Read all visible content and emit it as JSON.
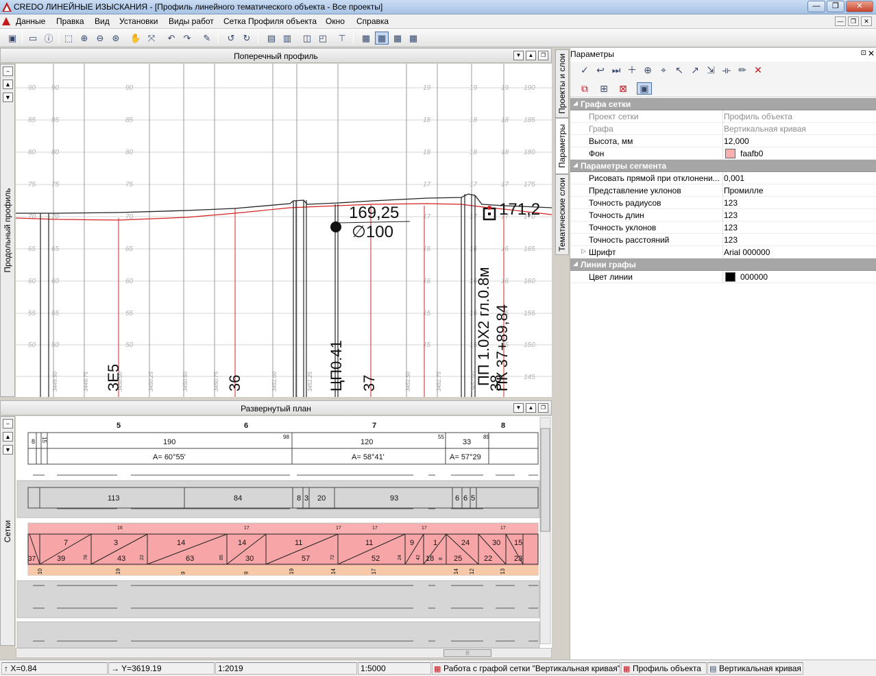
{
  "window": {
    "title": "CREDO ЛИНЕЙНЫЕ ИЗЫСКАНИЯ - [Профиль линейного тематического объекта - Все проекты]",
    "controls": [
      "—",
      "❐",
      "✕"
    ]
  },
  "menu": [
    "Данные",
    "Правка",
    "Вид",
    "Установки",
    "Виды работ",
    "Сетка Профиля объекта",
    "Окно",
    "Справка"
  ],
  "toolbar_icons": [
    "layers-icon",
    "window-icon",
    "info-icon",
    "zoom-box-icon",
    "zoom-in-icon",
    "zoom-out-icon",
    "zoom-all-icon",
    "pan-icon",
    "fit-icon",
    "zoom-prev-icon",
    "zoom-next-icon",
    "brush-icon",
    "undo-icon",
    "redo-icon",
    "table-icon",
    "chart-icon",
    "profile-icon",
    "profile2-icon",
    "insert-icon",
    "grid-ph-icon",
    "grid-pn-icon",
    "grid-pg-icon",
    "grid-pr-icon"
  ],
  "cross_section": {
    "title": "Поперечный профиль",
    "side_label": "Продольный профиль",
    "elev_left": [
      "190",
      "185",
      "180",
      "175",
      "170",
      "165",
      "160",
      "155",
      "150"
    ],
    "elev_mid": [
      "90",
      "85",
      "80",
      "75",
      "70",
      "65",
      "60",
      "55",
      "50"
    ],
    "elev_right": [
      "190",
      "185",
      "180",
      "175",
      "170",
      "165",
      "160",
      "155",
      "150",
      "145"
    ],
    "elev_inner": [
      "19",
      "18",
      "18",
      "17",
      "17",
      "16",
      "16",
      "15",
      "15"
    ],
    "callout_top": "169,25",
    "callout_bottom": "∅100",
    "callout_right": "171,2",
    "vertical_label_1": "ПП 1.0Х2 гл.0.8м",
    "vertical_label_2": "ПК 37+89,84",
    "vertical_label_3": "ЦП0.41",
    "pk_labels": [
      "ЗЕ5",
      "36",
      "37",
      "38"
    ],
    "small_labels": [
      "3449.50",
      "3449.75",
      "3450.00",
      "3450.25",
      "3450.50",
      "3450.75",
      "3451.00",
      "3451.25",
      "3451.50",
      "3451.75",
      "3452.00"
    ]
  },
  "plan": {
    "title": "Развернутый план",
    "side_label": "Сетки",
    "columns": [
      "5",
      "6",
      "7",
      "8"
    ],
    "row1_values": [
      "8",
      "15",
      "190",
      "98",
      "120",
      "55",
      "33",
      "89"
    ],
    "row1_angles": [
      "A= 60°55'",
      "A= 58°41'",
      "A= 57°29"
    ],
    "row2_values": [
      "113",
      "84",
      "8",
      "3",
      "20",
      "93",
      "6",
      "6",
      "5"
    ],
    "row3_top": [
      "7",
      "3",
      "14",
      "14",
      "11",
      "11",
      "9",
      "1",
      "24",
      "30",
      "15"
    ],
    "row3_bottom": [
      "37",
      "39",
      "43",
      "63",
      "30",
      "57",
      "52",
      "18",
      "25",
      "22",
      "23"
    ],
    "row3_marks": [
      "16",
      "17",
      "17",
      "17",
      "17",
      "17"
    ],
    "row3_small": [
      "78",
      "22",
      "85",
      "72",
      "24",
      "42",
      "8"
    ],
    "row3_foot": [
      "10",
      "19",
      "9",
      "9",
      "19",
      "14",
      "17",
      "14",
      "12",
      "13"
    ]
  },
  "properties": {
    "title": "Параметры",
    "pin": "⊡",
    "close": "✕",
    "tabs": [
      "Проекты и слои",
      "Параметры",
      "Тематические слои"
    ],
    "rows": [
      {
        "type": "section",
        "name": "Графа сетки"
      },
      {
        "type": "dim",
        "name": "Проект сетки",
        "value": "Профиль объекта"
      },
      {
        "type": "dim",
        "name": "Графа",
        "value": "Вертикальная кривая"
      },
      {
        "type": "row",
        "name": "Высота, мм",
        "value": "12,000"
      },
      {
        "type": "color",
        "name": "Фон",
        "value": "faafb0",
        "color": "#faafb0"
      },
      {
        "type": "section",
        "name": "Параметры сегмента"
      },
      {
        "type": "row",
        "name": "Рисовать прямой при отклонени...",
        "value": "0,001"
      },
      {
        "type": "row",
        "name": "Представление уклонов",
        "value": "Промилле"
      },
      {
        "type": "row",
        "name": "Точность радиусов",
        "value": "123"
      },
      {
        "type": "row",
        "name": "Точность длин",
        "value": "123"
      },
      {
        "type": "row",
        "name": "Точность уклонов",
        "value": "123"
      },
      {
        "type": "row",
        "name": "Точность расстояний",
        "value": "123"
      },
      {
        "type": "expand",
        "name": "Шрифт",
        "value": "Arial 000000"
      },
      {
        "type": "section",
        "name": "Линии графы"
      },
      {
        "type": "color",
        "name": "Цвет линии",
        "value": "000000",
        "color": "#000000"
      }
    ]
  },
  "status": {
    "x": "↑ X=0.84",
    "y": "→ Y=3619.19",
    "scale1": "1:2019",
    "scale2": "1:5000",
    "mode": "Работа с графой сетки \"Вертикальная кривая\"",
    "project": "Профиль объекта",
    "layer": "Вертикальная кривая"
  },
  "colors": {
    "accent": "#4a6fa5",
    "grid_fill": "#faafb0",
    "section": "#a6a6a6",
    "red_line": "#d42020"
  }
}
